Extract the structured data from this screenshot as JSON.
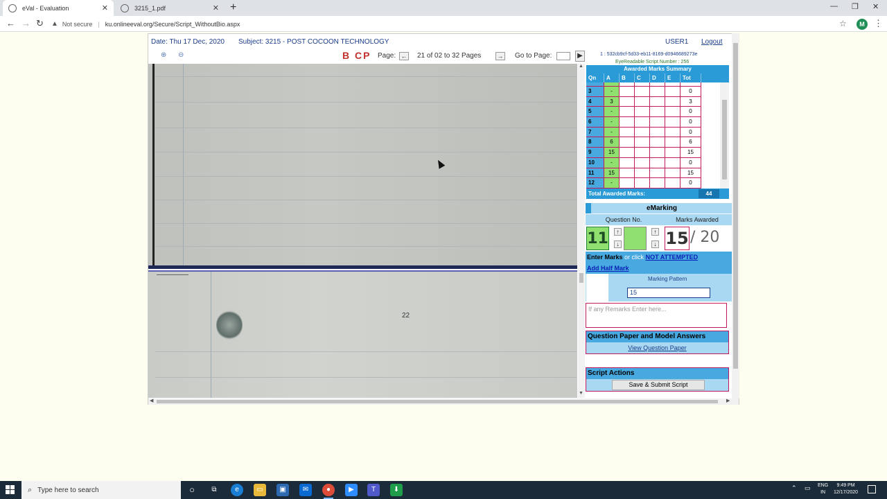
{
  "browser": {
    "tabs": [
      {
        "title": "eVal - Evaluation",
        "active": true
      },
      {
        "title": "3215_1.pdf",
        "active": false
      }
    ],
    "security_label": "Not secure",
    "url": "ku.onlineeval.org/Secure/Script_WithoutBio.aspx",
    "profile_initial": "M"
  },
  "header": {
    "date": "Date: Thu 17 Dec, 2020",
    "subject": "Subject: 3215 - POST COCOON TECHNOLOGY",
    "user": "USER1",
    "logout": "Logout"
  },
  "toolbar": {
    "tools_label": "B CP",
    "page_label": "Page:",
    "page_value": "21 of 02 to 32 Pages",
    "goto_label": "Go to Page:",
    "script_id": "1 : 532cb9cf-5d33-eb11-8169-d0946689273e",
    "eye_readable": "EyeReadable Script Number : 256"
  },
  "viewer": {
    "page_number_text": "22"
  },
  "summary": {
    "title": "Awarded Marks Summary",
    "columns": [
      "Qn",
      "A",
      "B",
      "C",
      "D",
      "E",
      "Tot"
    ],
    "rows": [
      {
        "qn": "3",
        "a": "-",
        "tot": "0"
      },
      {
        "qn": "4",
        "a": "3",
        "tot": "3"
      },
      {
        "qn": "5",
        "a": "-",
        "tot": "0"
      },
      {
        "qn": "6",
        "a": "-",
        "tot": "0"
      },
      {
        "qn": "7",
        "a": "-",
        "tot": "0"
      },
      {
        "qn": "8",
        "a": "6",
        "tot": "6"
      },
      {
        "qn": "9",
        "a": "15",
        "tot": "15"
      },
      {
        "qn": "10",
        "a": "-",
        "tot": "0"
      },
      {
        "qn": "11",
        "a": "15",
        "tot": "15"
      },
      {
        "qn": "12",
        "a": "-",
        "tot": "0"
      }
    ],
    "total_label": "Total Awarded Marks:",
    "total_value": "44"
  },
  "emarking": {
    "title": "eMarking",
    "question_label": "Question No.",
    "marks_label": "Marks Awarded",
    "question_no": "11",
    "marks_awarded": "15",
    "out_of": "/ 20",
    "enter_marks": "Enter Marks",
    "or_click": "or click",
    "not_attempted": "NOT ATTEMPTED",
    "half_mark": "Add Half Mark",
    "pattern_label": "Marking Pattern",
    "pattern_value": "15",
    "remarks_placeholder": "If any Remarks Enter here..."
  },
  "qpaper": {
    "title": "Question Paper and Model Answers",
    "link": "View Question Paper"
  },
  "actions": {
    "title": "Script Actions",
    "save_submit": "Save & Submit Script"
  },
  "taskbar": {
    "search_placeholder": "Type here to search",
    "lang_top": "ENG",
    "lang_bottom": "IN",
    "time": "9:49 PM",
    "date": "12/17/2020"
  }
}
